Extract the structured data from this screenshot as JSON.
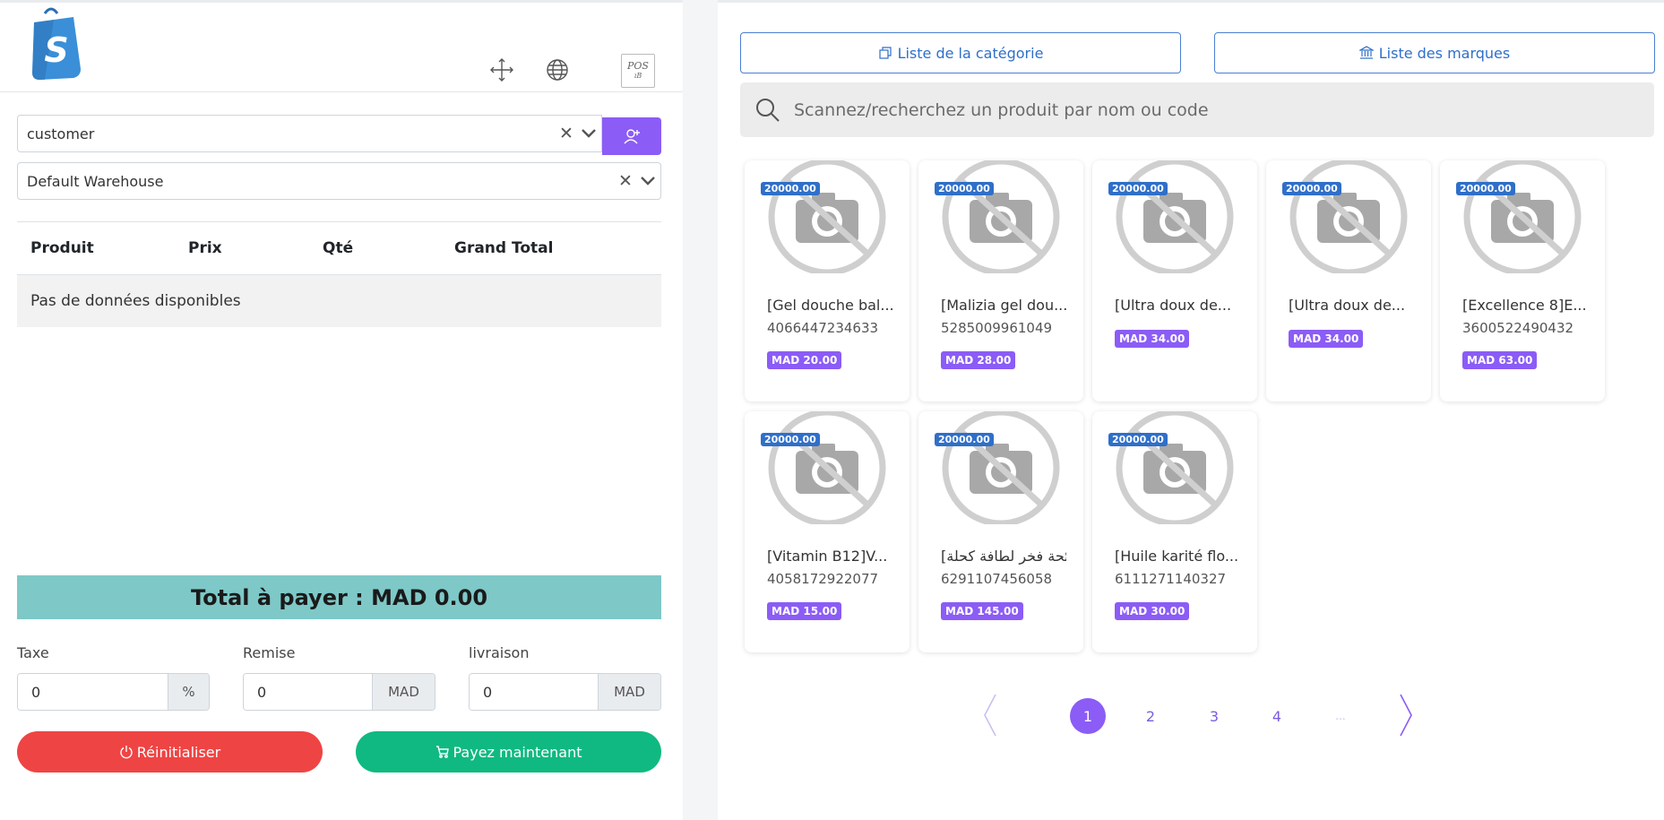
{
  "header": {
    "logo_letter": "S",
    "pos_icon_text": "POS",
    "pos_icon_sub": "ıB"
  },
  "customer_select": {
    "value": "customer"
  },
  "warehouse_select": {
    "value": "Default Warehouse"
  },
  "cart": {
    "columns": [
      "Produit",
      "Prix",
      "Qté",
      "Grand Total"
    ],
    "empty_text": "Pas de données disponibles"
  },
  "total": {
    "label": "Total à payer : MAD 0.00"
  },
  "fields": {
    "tax": {
      "label": "Taxe",
      "value": "0",
      "unit": "%"
    },
    "discount": {
      "label": "Remise",
      "value": "0",
      "unit": "MAD"
    },
    "shipping": {
      "label": "livraison",
      "value": "0",
      "unit": "MAD"
    }
  },
  "actions": {
    "reset_label": "Réinitialiser",
    "pay_label": "Payez maintenant"
  },
  "filters": {
    "category_label": "Liste de la catégorie",
    "brand_label": "Liste des marques"
  },
  "search": {
    "placeholder": "Scannez/recherchez un produit par nom ou code"
  },
  "products": [
    {
      "stock": "20000.00",
      "name": "[Gel douche bal...",
      "code": "4066447234633",
      "price": "MAD 20.00"
    },
    {
      "stock": "20000.00",
      "name": "[Malizia gel dou...",
      "code": "5285009961049",
      "price": "MAD 28.00"
    },
    {
      "stock": "20000.00",
      "name": "[Ultra doux de...",
      "code": "",
      "price": "MAD 34.00"
    },
    {
      "stock": "20000.00",
      "name": "[Ultra doux de...",
      "code": "",
      "price": "MAD 34.00"
    },
    {
      "stock": "20000.00",
      "name": "[Excellence 8]E...",
      "code": "3600522490432",
      "price": "MAD 63.00"
    },
    {
      "stock": "20000.00",
      "name": "[Vitamin B12]V...",
      "code": "4058172922077",
      "price": "MAD 15.00"
    },
    {
      "stock": "20000.00",
      "name": "[رائحة فخر لطافة كحلة...",
      "code": "6291107456058",
      "price": "MAD 145.00"
    },
    {
      "stock": "20000.00",
      "name": "[Huile karité flo...",
      "code": "6111271140327",
      "price": "MAD 30.00"
    }
  ],
  "pagination": {
    "pages": [
      "1",
      "2",
      "3",
      "4"
    ],
    "ellipsis": "...",
    "current": "1"
  },
  "colors": {
    "accent": "#8b5cf6",
    "primary_blue": "#2f6fc9",
    "total_bar": "#7ec8c8",
    "danger": "#ef4444",
    "success": "#10b981"
  }
}
